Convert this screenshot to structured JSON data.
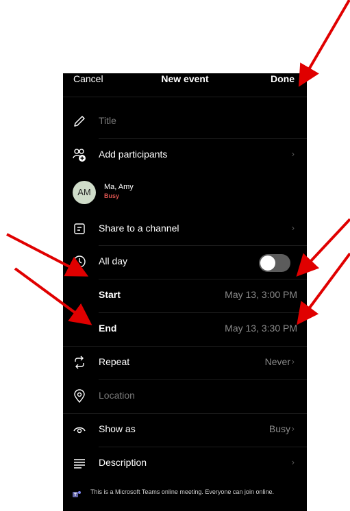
{
  "header": {
    "cancel_label": "Cancel",
    "title": "New event",
    "done_label": "Done"
  },
  "rows": {
    "title_placeholder": "Title",
    "add_participants": "Add participants",
    "participant": {
      "initials": "AM",
      "name": "Ma, Amy",
      "status": "Busy"
    },
    "share_channel": "Share to a channel",
    "all_day": "All day",
    "start": {
      "label": "Start",
      "value": "May 13, 3:00 PM"
    },
    "end": {
      "label": "End",
      "value": "May 13, 3:30 PM"
    },
    "repeat": {
      "label": "Repeat",
      "value": "Never"
    },
    "location_placeholder": "Location",
    "show_as": {
      "label": "Show as",
      "value": "Busy"
    },
    "description": "Description"
  },
  "footer_text": "This is a Microsoft Teams online meeting. Everyone can join online.",
  "colors": {
    "background": "#000000",
    "status_busy": "#d9534f",
    "arrow": "#e00000"
  },
  "icons": [
    "pencil-icon",
    "add-participants-icon",
    "channel-icon",
    "clock-icon",
    "repeat-icon",
    "location-pin-icon",
    "eye-icon",
    "description-lines-icon",
    "teams-icon",
    "chevron-right-icon"
  ],
  "all_day_toggle": {
    "on": false
  }
}
